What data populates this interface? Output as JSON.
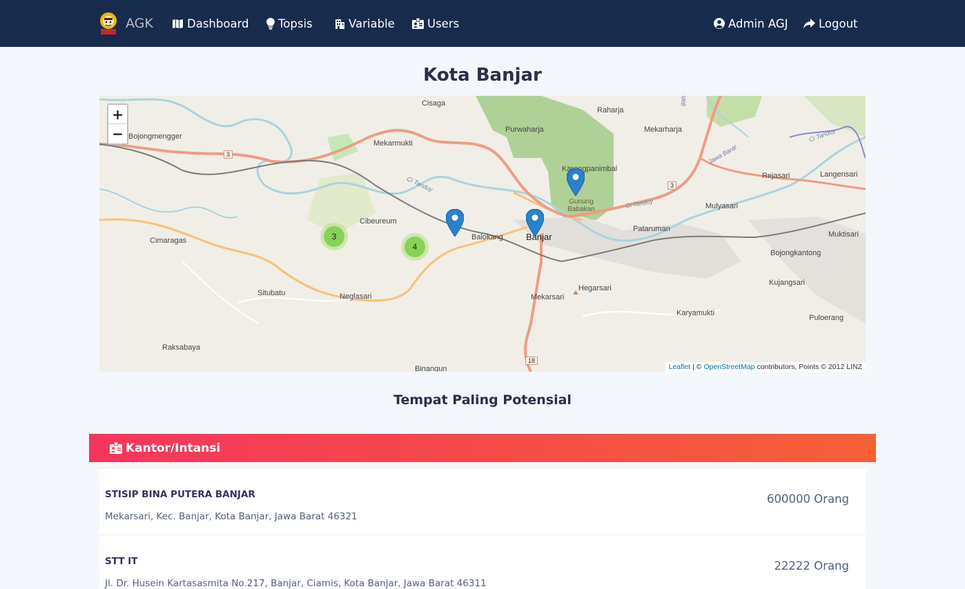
{
  "navbar": {
    "brand": "AGK",
    "items": [
      {
        "label": "Dashboard",
        "icon": "map-icon"
      },
      {
        "label": "Topsis",
        "icon": "lightbulb-icon"
      },
      {
        "label": "Variable",
        "icon": "building-icon"
      },
      {
        "label": "Users",
        "icon": "id-card-icon"
      }
    ],
    "user": {
      "label": "Admin AGJ",
      "icon": "user-circle-icon"
    },
    "logout": {
      "label": "Logout",
      "icon": "share-arrow-icon"
    }
  },
  "page_title": "Kota Banjar",
  "map": {
    "zoom_in": "+",
    "zoom_out": "−",
    "places": {
      "bojongmengger": "Bojongmengger",
      "cisaga": "Cisaga",
      "raharja": "Raharja",
      "purwaharja": "Purwaharja",
      "mekarharja": "Mekarharja",
      "mekarmukti": "Mekarmukti",
      "karangpanimbal": "Karangpanimbal",
      "rejasari": "Rejasari",
      "langensari": "Langensari",
      "gunung_babakan": "Gunung Babakan",
      "mulyasari": "Mulyasari",
      "cibeureum": "Cibeureum",
      "balokang": "Balokang",
      "banjar": "Banjar",
      "pataruman": "Pataruman",
      "muktisari": "Muktisari",
      "cimaragas": "Cimaragas",
      "bojongkantong": "Bojongkantong",
      "hegarsari": "Hegarsari",
      "kujangsari": "Kujangsari",
      "situbatu": "Situbatu",
      "neglasari": "Neglasari",
      "mekarsari": "Mekarsari",
      "karyamukti": "Karyamukti",
      "puloerang": "Puloerang",
      "raksabaya": "Raksabaya",
      "binangun": "Binangun",
      "river_1": "Ci Tanduy",
      "river_2": "Ci Tanduy",
      "river_3": "Ci Tanduy",
      "jawa_barat": "Jawa Barat",
      "edge": "gah"
    },
    "road_shields": {
      "r1": "3",
      "r2": "3",
      "r3": "18"
    },
    "clusters": [
      {
        "count": "3"
      },
      {
        "count": "4"
      }
    ],
    "attribution": {
      "leaflet": "Leaflet",
      "sep": " | © ",
      "osm": "OpenStreetMap",
      "rest": " contributors, Points © 2012 LINZ"
    }
  },
  "section_title": "Tempat Paling Potensial",
  "category": {
    "label": "Kantor/Intansi",
    "icon": "id-card-icon"
  },
  "places": [
    {
      "name": "STISIP BINA PUTERA BANJAR",
      "address": "Mekarsari, Kec. Banjar, Kota Banjar, Jawa Barat 46321",
      "count": "600000 Orang"
    },
    {
      "name": "STT IT",
      "address": "Jl. Dr. Husein Kartasasmita No.217, Banjar, Ciamis, Kota Banjar, Jawa Barat 46311",
      "count": "22222 Orang"
    }
  ],
  "colors": {
    "navbar": "#172b4d",
    "banner_start": "#f5365c",
    "banner_end": "#f56036",
    "marker": "#2a81cb"
  }
}
